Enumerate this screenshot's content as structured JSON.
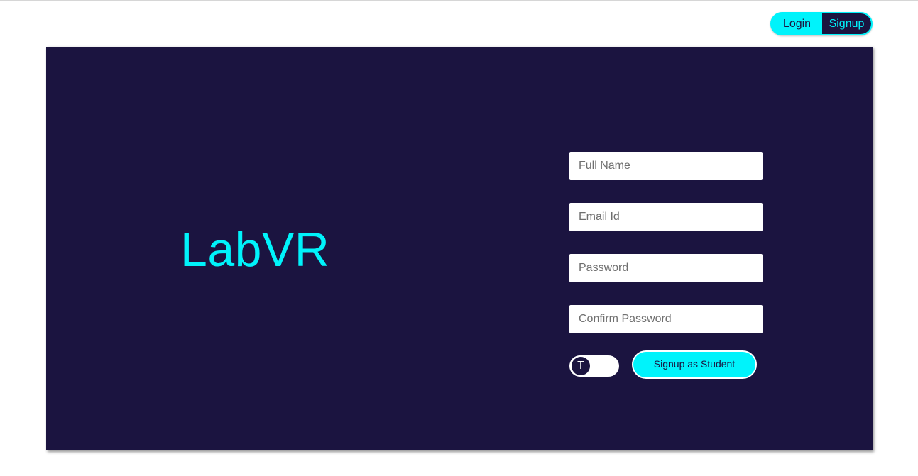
{
  "auth_toggle": {
    "login_label": "Login",
    "signup_label": "Signup",
    "active": "Signup"
  },
  "brand": {
    "title": "LabVR"
  },
  "form": {
    "full_name": {
      "value": "",
      "placeholder": "Full Name"
    },
    "email": {
      "value": "",
      "placeholder": "Email Id"
    },
    "password": {
      "value": "",
      "placeholder": "Password"
    },
    "confirm_password": {
      "value": "",
      "placeholder": "Confirm Password"
    },
    "role_switch": {
      "knob_label": "T",
      "checked": false
    },
    "submit_label": "Signup as Student"
  },
  "colors": {
    "accent": "#00f3fb",
    "card_background": "#1b1440",
    "page_background": "#ffffff",
    "field_background": "#ffffff"
  }
}
